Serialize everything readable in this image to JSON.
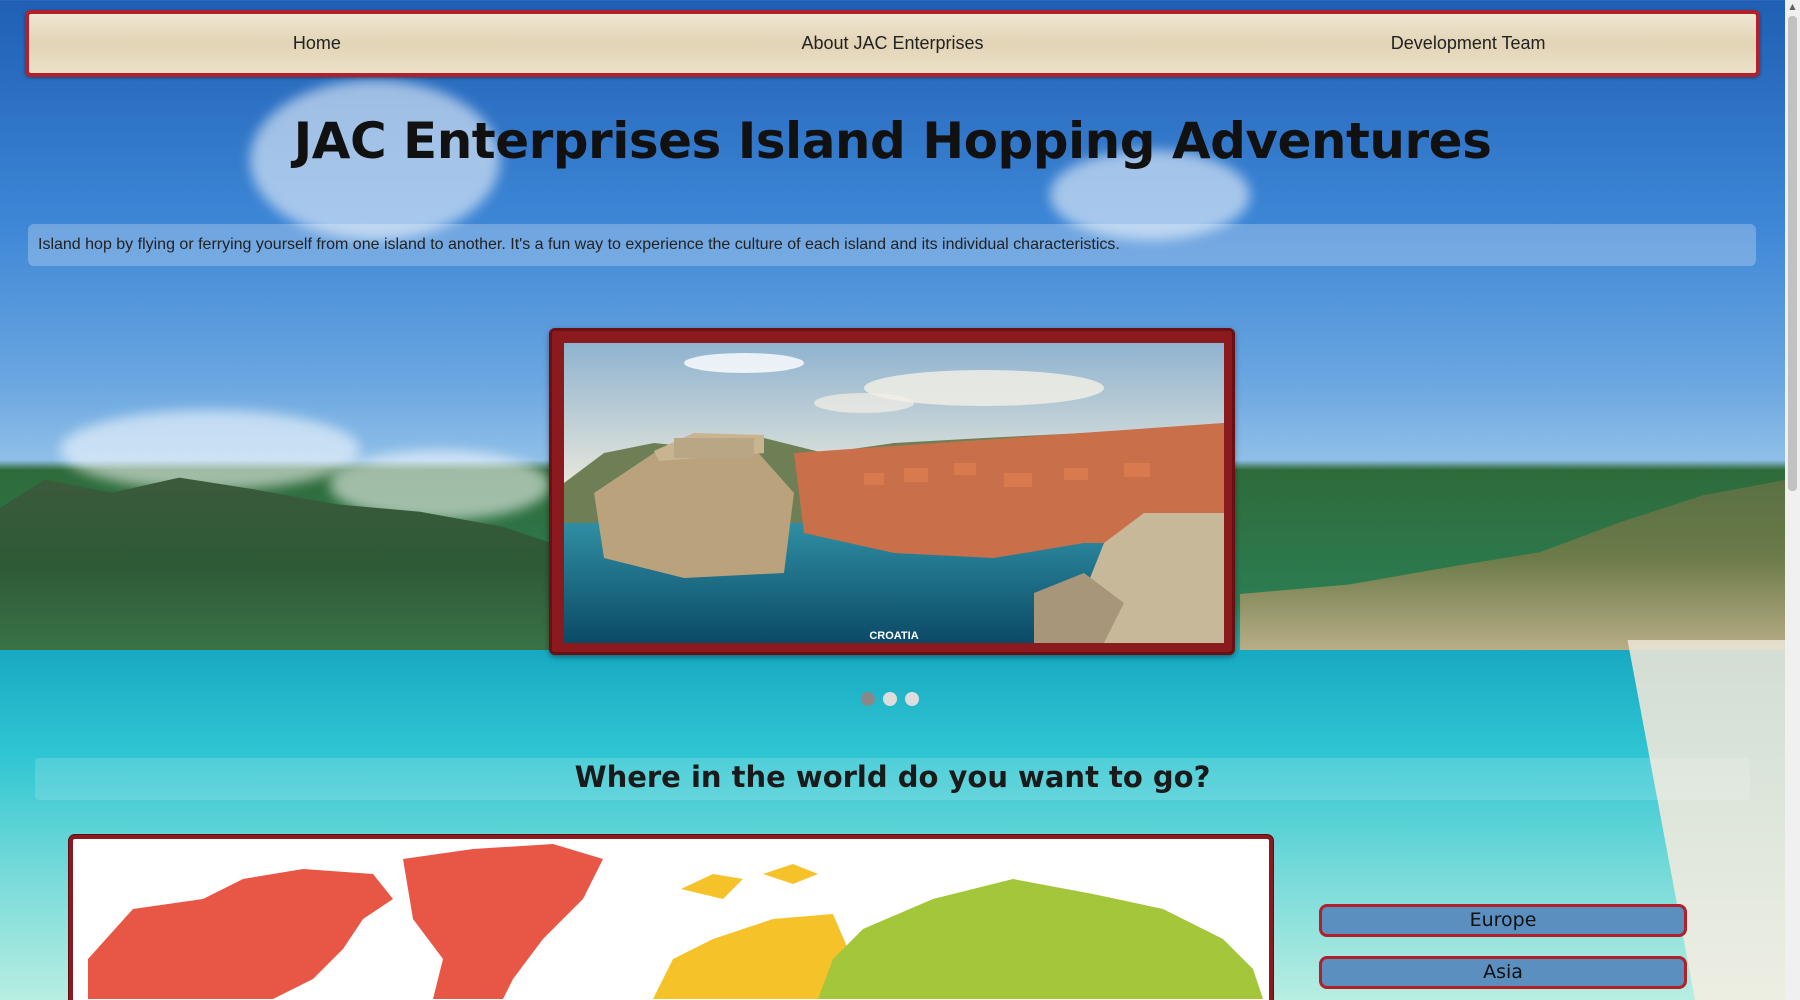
{
  "nav": {
    "home": "Home",
    "about": "About JAC Enterprises",
    "team": "Development Team"
  },
  "hero": {
    "title": "JAC Enterprises Island Hopping Adventures",
    "intro": "Island hop by flying or ferrying yourself from one island to another. It's a fun way to experience the culture of each island and its individual characteristics."
  },
  "carousel": {
    "caption": "CROATIA",
    "slide_count": 3,
    "active_index": 0
  },
  "map_section": {
    "question": "Where in the world do you want to go?",
    "regions": [
      "Europe",
      "Asia"
    ]
  },
  "colors": {
    "accent": "#b1212b",
    "button": "#5b8fbf",
    "map_red": "#e85646",
    "map_yellow": "#f5c22a",
    "map_green": "#a3c63a"
  }
}
